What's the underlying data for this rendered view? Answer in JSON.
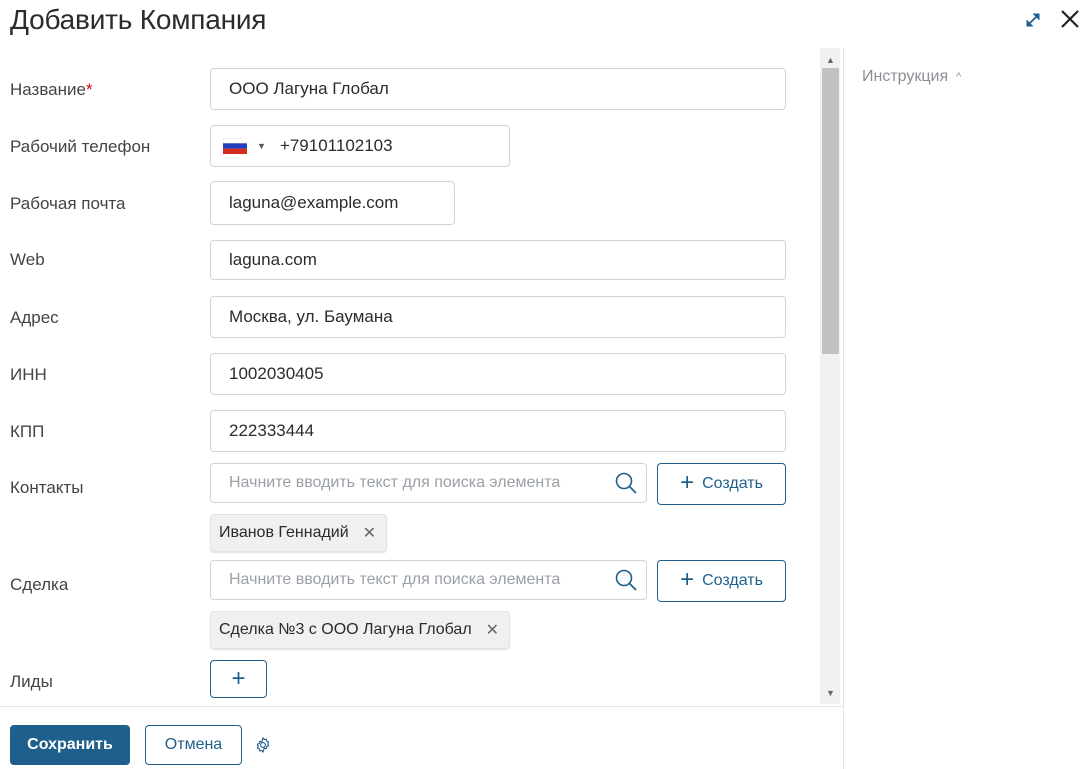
{
  "dialog": {
    "title": "Добавить Компания"
  },
  "fields": {
    "name": {
      "label": "Название",
      "required_mark": "*",
      "value": "ООО Лагуна Глобал"
    },
    "phone": {
      "label": "Рабочий телефон",
      "value": "+79101102103",
      "country_flag": "ru-flag"
    },
    "email": {
      "label": "Рабочая почта",
      "value": "laguna@example.com"
    },
    "web": {
      "label": "Web",
      "value": "laguna.com"
    },
    "address": {
      "label": "Адрес",
      "value": "Москва, ул. Баумана"
    },
    "inn": {
      "label": "ИНН",
      "value": "1002030405"
    },
    "kpp": {
      "label": "КПП",
      "value": "222333444"
    },
    "contacts": {
      "label": "Контакты",
      "placeholder": "Начните вводить текст для поиска элемента",
      "create_label": "Создать",
      "chips": [
        "Иванов Геннадий"
      ]
    },
    "deal": {
      "label": "Сделка",
      "placeholder": "Начните вводить текст для поиска элемента",
      "create_label": "Создать",
      "chips": [
        "Сделка №3 с ООО Лагуна Глобал"
      ]
    },
    "leads": {
      "label": "Лиды",
      "add_label": "+"
    }
  },
  "side_panel": {
    "instruction_label": "Инструкция"
  },
  "footer": {
    "save_label": "Сохранить",
    "cancel_label": "Отмена"
  },
  "colors": {
    "accent": "#1f5f8b",
    "required": "#d0021b",
    "border": "#cfd4d9",
    "chip_bg": "#eef0f2"
  }
}
